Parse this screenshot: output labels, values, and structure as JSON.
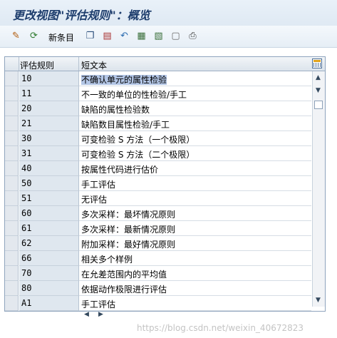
{
  "window": {
    "title": "更改视图\"评估规则\"：概览"
  },
  "toolbar": {
    "new_entries_label": "新条目",
    "icons": [
      "glasses-icon",
      "refresh-icon",
      "copy-icon",
      "delete-icon",
      "undo-icon",
      "select-all-icon",
      "select-block-icon",
      "deselect-icon",
      "print-icon"
    ]
  },
  "table": {
    "columns": [
      "评估规则",
      "短文本"
    ],
    "rows": [
      {
        "code": "10",
        "text": "不确认单元的属性检验"
      },
      {
        "code": "11",
        "text": "不一致的单位的性检验/手工"
      },
      {
        "code": "20",
        "text": "缺陷的属性检验数"
      },
      {
        "code": "21",
        "text": "缺陷数目属性检验/手工"
      },
      {
        "code": "30",
        "text": "可变检验 S 方法（一个极限）"
      },
      {
        "code": "31",
        "text": "可变检验 S 方法（二个极限）"
      },
      {
        "code": "40",
        "text": "按属性代码进行估价"
      },
      {
        "code": "50",
        "text": "手工评估"
      },
      {
        "code": "51",
        "text": "无评估"
      },
      {
        "code": "60",
        "text": "多次采样：最坏情况原则"
      },
      {
        "code": "61",
        "text": "多次采样：最新情况原则"
      },
      {
        "code": "62",
        "text": "附加采样：最好情况原则"
      },
      {
        "code": "66",
        "text": "相关多个样例"
      },
      {
        "code": "70",
        "text": "在允差范围内的平均值"
      },
      {
        "code": "80",
        "text": "依据动作极限进行评估"
      },
      {
        "code": "A1",
        "text": "手工评估"
      }
    ]
  },
  "watermark": "https://blog.csdn.net/weixin_40672823",
  "colors": {
    "selection": "#b3c6e6",
    "key_column_bg": "#dfe7ef",
    "title": "#1c3c6c"
  }
}
